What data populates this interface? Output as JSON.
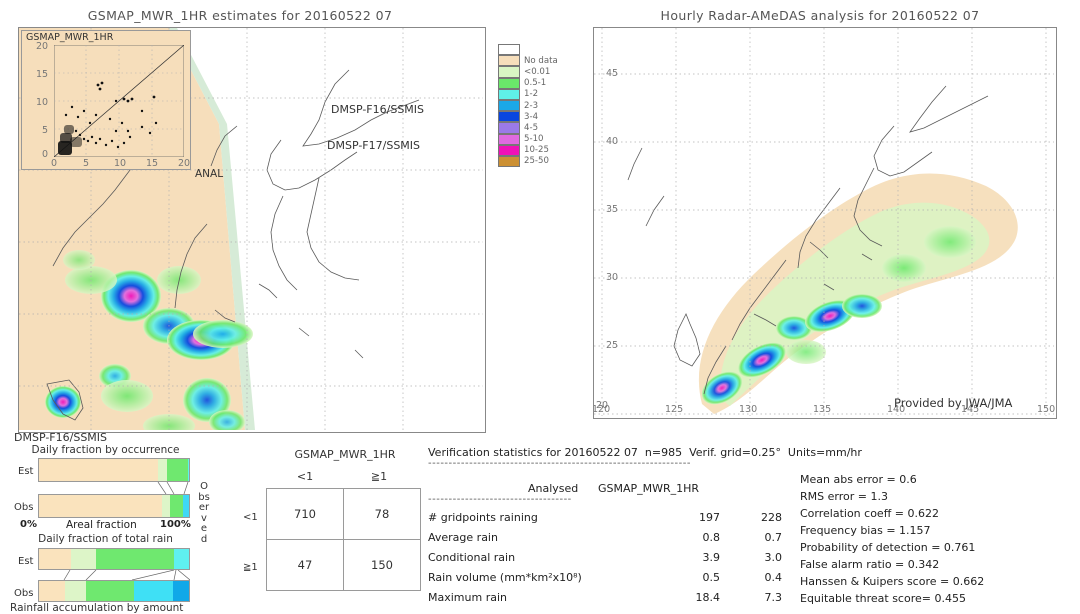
{
  "left_panel": {
    "title": "GSMAP_MWR_1HR estimates for 20160522 07",
    "inset_title": "GSMAP_MWR_1HR",
    "inset_xlabel": "ANAL",
    "inset_yticks": [
      "0",
      "5",
      "10",
      "15",
      "20"
    ],
    "inset_xticks": [
      "0",
      "5",
      "10",
      "15",
      "20"
    ],
    "annotations": [
      "DMSP-F16/SSMIS",
      "DMSP-F17/SSMIS"
    ],
    "sensor_caption": "DMSP-F16/SSMIS"
  },
  "right_panel": {
    "title": "Hourly Radar-AMeDAS analysis for 20160522 07",
    "credit": "Provided by JWA/JMA",
    "lat_ticks": [
      "45",
      "40",
      "35",
      "30",
      "25",
      "20"
    ],
    "lon_ticks": [
      "120",
      "125",
      "130",
      "135",
      "140",
      "145",
      "150"
    ]
  },
  "legend": {
    "entries": [
      {
        "label": "",
        "color": "#ffffff"
      },
      {
        "label": "No data",
        "color": "#f6debb"
      },
      {
        "label": "<0.01",
        "color": "#d9f5c4"
      },
      {
        "label": "0.5-1",
        "color": "#6ae86a"
      },
      {
        "label": "1-2",
        "color": "#5ff0e8"
      },
      {
        "label": "2-3",
        "color": "#1ba8e8"
      },
      {
        "label": "3-4",
        "color": "#0a46e0"
      },
      {
        "label": "4-5",
        "color": "#9b7ae8"
      },
      {
        "label": "5-10",
        "color": "#e06ae0"
      },
      {
        "label": "10-25",
        "color": "#f010b8"
      },
      {
        "label": "25-50",
        "color": "#cc9033"
      }
    ]
  },
  "bars": {
    "chart1_title": "Daily fraction by occurrence",
    "chart2_title": "Daily fraction of total rain",
    "row_est": "Est",
    "row_obs": "Obs",
    "axis_left": "0%",
    "axis_center": "Areal fraction",
    "axis_right": "100%",
    "caption": "Rainfall accumulation by amount",
    "chart1_est": [
      {
        "color": "#fae3bd",
        "pct": 79
      },
      {
        "color": "#ddf5c8",
        "pct": 6
      },
      {
        "color": "#6fe86f",
        "pct": 14
      },
      {
        "color": "#5ff0f0",
        "pct": 1
      }
    ],
    "chart1_obs": [
      {
        "color": "#fae3bd",
        "pct": 82
      },
      {
        "color": "#ddf5c8",
        "pct": 5
      },
      {
        "color": "#6fe86f",
        "pct": 9
      },
      {
        "color": "#3fd8f5",
        "pct": 4
      }
    ],
    "chart2_est": [
      {
        "color": "#fae3bd",
        "pct": 21
      },
      {
        "color": "#ddf5c8",
        "pct": 17
      },
      {
        "color": "#6fe86f",
        "pct": 52
      },
      {
        "color": "#5ff0f0",
        "pct": 10
      }
    ],
    "chart2_obs": [
      {
        "color": "#fae3bd",
        "pct": 17
      },
      {
        "color": "#ddf5c8",
        "pct": 14
      },
      {
        "color": "#6fe86f",
        "pct": 32
      },
      {
        "color": "#3fe0f5",
        "pct": 26
      },
      {
        "color": "#10a8e8",
        "pct": 11
      }
    ]
  },
  "contingency": {
    "col_header": "GSMAP_MWR_1HR",
    "col_labels": [
      "<1",
      "≧1"
    ],
    "row_labels": [
      "<1",
      "≧1"
    ],
    "row_axis": "Observed",
    "cells": [
      [
        "710",
        "78"
      ],
      [
        "47",
        "150"
      ]
    ]
  },
  "verification": {
    "header": "Verification statistics for 20160522 07  n=985  Verif. grid=0.25°  Units=mm/hr",
    "divider": "----------------------------------------------------------------",
    "col_analysed": "Analysed",
    "col_product": "GSMAP_MWR_1HR",
    "subdivider": "-----------------------------------",
    "rows": [
      {
        "name": "# gridpoints raining",
        "analysed": "197",
        "product": "228"
      },
      {
        "name": "Average rain",
        "analysed": "0.8",
        "product": "0.7"
      },
      {
        "name": "Conditional rain",
        "analysed": "3.9",
        "product": "3.0"
      },
      {
        "name": "Rain volume (mm*km²x10⁸)",
        "analysed": "0.5",
        "product": "0.4"
      },
      {
        "name": "Maximum rain",
        "analysed": "18.4",
        "product": "7.3"
      }
    ],
    "scores": [
      "Mean abs error = 0.6",
      "RMS error = 1.3",
      "Correlation coeff = 0.622",
      "Frequency bias = 1.157",
      "Probability of detection = 0.761",
      "False alarm ratio = 0.342",
      "Hanssen & Kuipers score = 0.662",
      "Equitable threat score= 0.455"
    ]
  }
}
